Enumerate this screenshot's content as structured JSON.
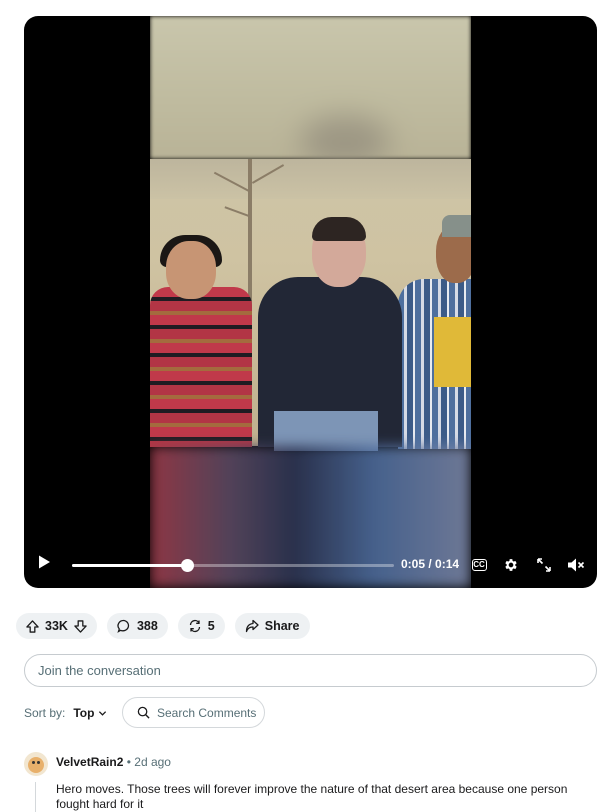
{
  "player": {
    "current_time": "0:05",
    "duration": "0:14",
    "time_separator": " / ",
    "progress": 0.357,
    "icons": {
      "play": "play-icon",
      "captions": "captions-icon",
      "settings": "settings-icon",
      "fullscreen": "fullscreen-icon",
      "mute": "muted-icon"
    },
    "captions_label": "CC"
  },
  "actions": {
    "votes": "33K",
    "comments": "388",
    "crossposts": "5",
    "share_label": "Share"
  },
  "comment_box": {
    "placeholder": "Join the conversation"
  },
  "sort": {
    "label": "Sort by:",
    "value": "Top",
    "search_label": "Search Comments"
  },
  "comments": [
    {
      "author": "VelvetRain2",
      "separator": "•",
      "age": "2d ago",
      "text": "Hero moves. Those trees will forever improve the nature of that desert area because one person fought hard for it"
    }
  ],
  "colors": {
    "pill_bg": "#eef1f3",
    "muted_text": "#576f76",
    "player_bg": "#000000"
  }
}
